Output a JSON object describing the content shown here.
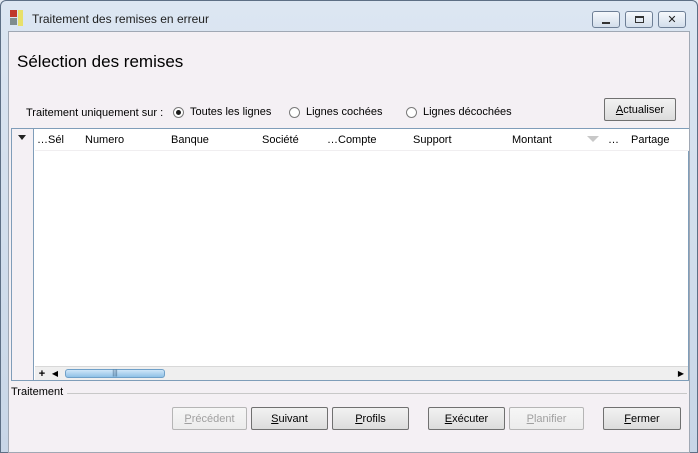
{
  "window": {
    "title": "Traitement des remises en erreur",
    "controls": {
      "minimize": "minimize",
      "maximize": "maximize",
      "close": "close"
    }
  },
  "page": {
    "heading": "Sélection des remises"
  },
  "filter": {
    "label": "Traitement uniquement sur :",
    "options": [
      {
        "label": "Toutes les lignes",
        "selected": true
      },
      {
        "label": "Lignes cochées",
        "selected": false
      },
      {
        "label": "Lignes décochées",
        "selected": false
      }
    ]
  },
  "buttons": {
    "refresh": {
      "label_first": "A",
      "label_rest": "ctualiser"
    },
    "previous": {
      "label_first": "P",
      "label_rest": "récédent"
    },
    "next": {
      "label_first": "S",
      "label_rest": "uivant"
    },
    "profiles": {
      "label_first": "P",
      "label_rest": "rofils"
    },
    "execute": {
      "label_first": "E",
      "label_rest": "xécuter"
    },
    "schedule": {
      "label_first": "P",
      "label_rest": "lanifier"
    },
    "close": {
      "label_first": "F",
      "label_rest": "ermer"
    }
  },
  "table": {
    "columns": [
      "…Sél",
      "Numero",
      "Banque",
      "Société",
      "…Compte",
      "Support",
      "Montant",
      "…",
      "Partage"
    ],
    "rows": []
  },
  "status": {
    "label": "Traitement"
  }
}
